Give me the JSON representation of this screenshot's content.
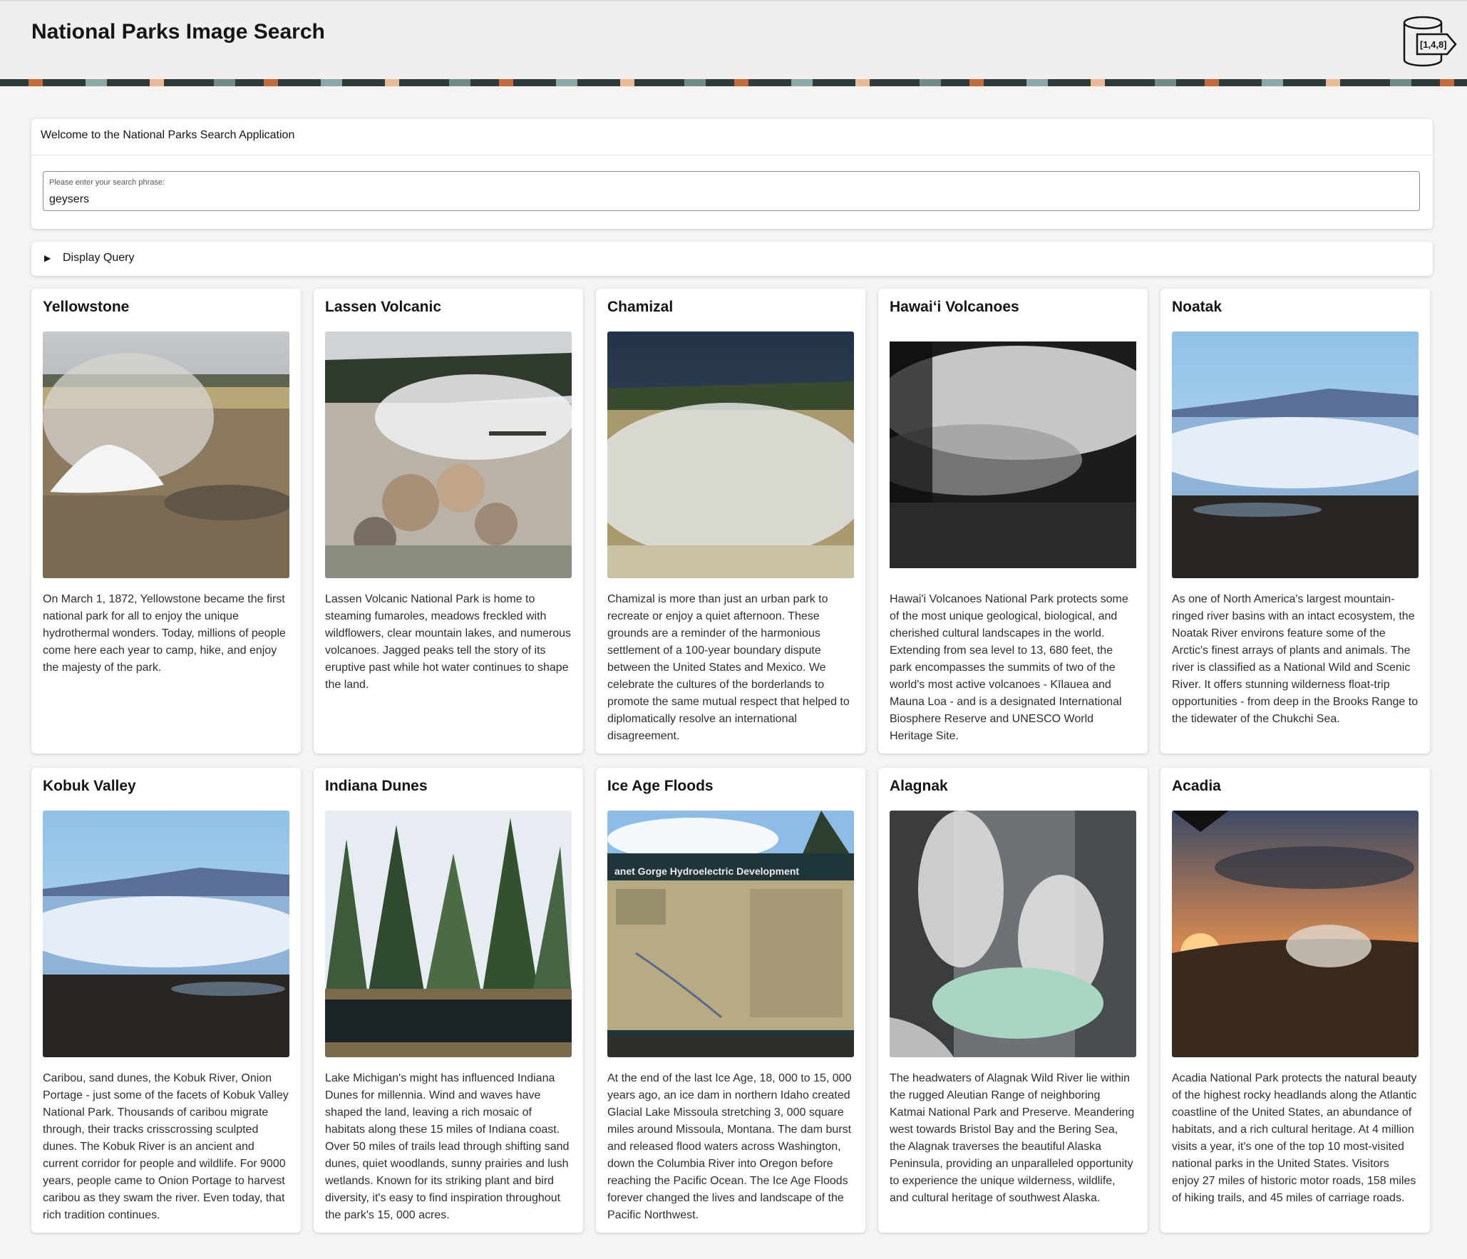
{
  "header": {
    "title": "National Parks Image Search",
    "logo_label": "[1,4,8]",
    "logo_icon": "vector-database-icon"
  },
  "welcome": {
    "title": "Welcome to the National Parks Search Application",
    "search_label": "Please enter your search phrase:",
    "search_value": "geysers"
  },
  "query_toggle": {
    "label": "Display Query",
    "icon": "caret-right-icon"
  },
  "cards": [
    {
      "title": "Yellowstone",
      "description": "On March 1, 1872, Yellowstone became the first national park for all to enjoy the unique hydrothermal wonders. Today, millions of people come here each year to camp, hike, and enjoy the majesty of the park."
    },
    {
      "title": "Lassen Volcanic",
      "description": "Lassen Volcanic National Park is home to steaming fumaroles, meadows freckled with wildflowers, clear mountain lakes, and numerous volcanoes. Jagged peaks tell the story of its eruptive past while hot water continues to shape the land."
    },
    {
      "title": "Chamizal",
      "description": "Chamizal is more than just an urban park to recreate or enjoy a quiet afternoon. These grounds are a reminder of the harmonious settlement of a 100-year boundary dispute between the United States and Mexico. We celebrate the cultures of the borderlands to promote the same mutual respect that helped to diplomatically resolve an international disagreement."
    },
    {
      "title": "Hawai‘i Volcanoes",
      "description": "Hawai'i Volcanoes National Park protects some of the most unique geological, biological, and cherished cultural landscapes in the world. Extending from sea level to 13, 680 feet, the park encompasses the summits of two of the world's most active volcanoes - Kīlauea and Mauna Loa - and is a designated International Biosphere Reserve and UNESCO World Heritage Site."
    },
    {
      "title": "Noatak",
      "description": "As one of North America's largest mountain-ringed river basins with an intact ecosystem, the Noatak River environs feature some of the Arctic's finest arrays of plants and animals. The river is classified as a National Wild and Scenic River. It offers stunning wilderness float-trip opportunities - from deep in the Brooks Range to the tidewater of the Chukchi Sea."
    },
    {
      "title": "Kobuk Valley",
      "description": "Caribou, sand dunes, the Kobuk River, Onion Portage - just some of the facets of Kobuk Valley National Park. Thousands of caribou migrate through, their tracks crisscrossing sculpted dunes. The Kobuk River is an ancient and current corridor for people and wildlife. For 9000 years, people came to Onion Portage to harvest caribou as they swam the river. Even today, that rich tradition continues."
    },
    {
      "title": "Indiana Dunes",
      "description": "Lake Michigan's might has influenced Indiana Dunes for millennia. Wind and waves have shaped the land, leaving a rich mosaic of habitats along these 15 miles of Indiana coast. Over 50 miles of trails lead through shifting sand dunes, quiet woodlands, sunny prairies and lush wetlands. Known for its striking plant and bird diversity, it's easy to find inspiration throughout the park's 15, 000 acres."
    },
    {
      "title": "Ice Age Floods",
      "description": "At the end of the last Ice Age, 18, 000 to 15, 000 years ago, an ice dam in northern Idaho created Glacial Lake Missoula stretching 3, 000 square miles around Missoula, Montana. The dam burst and released flood waters across Washington, down the Columbia River into Oregon before reaching the Pacific Ocean. The Ice Age Floods forever changed the lives and landscape of the Pacific Northwest.",
      "sign_text": "anet Gorge Hydroelectric Development"
    },
    {
      "title": "Alagnak",
      "description": "The headwaters of Alagnak Wild River lie within the rugged Aleutian Range of neighboring Katmai National Park and Preserve. Meandering west towards Bristol Bay and the Bering Sea, the Alagnak traverses the beautiful Alaska Peninsula, providing an unparalleled opportunity to experience the unique wilderness, wildlife, and cultural heritage of southwest Alaska."
    },
    {
      "title": "Acadia",
      "description": "Acadia National Park protects the natural beauty of the highest rocky headlands along the Atlantic coastline of the United States, an abundance of habitats, and a rich cultural heritage. At 4 million visits a year, it's one of the top 10 most-visited national parks in the United States. Visitors enjoy 27 miles of historic motor roads, 158 miles of hiking trails, and 45 miles of carriage roads."
    }
  ]
}
